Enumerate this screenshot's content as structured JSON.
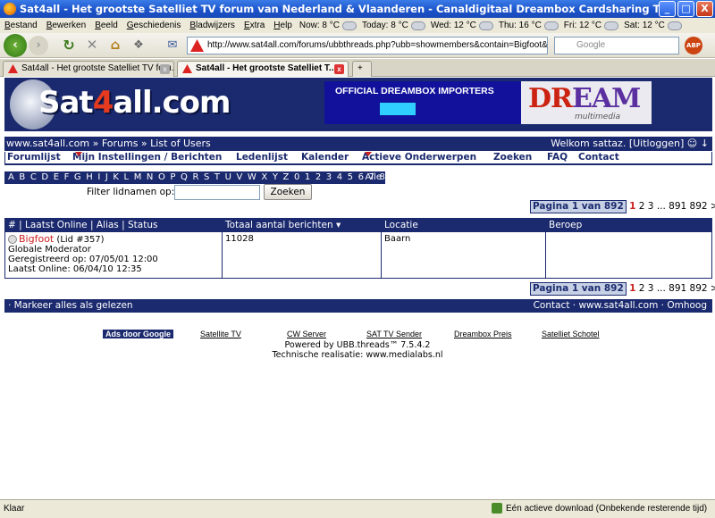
{
  "window": {
    "title": "Sat4all - Het grootste Satelliet TV forum van Nederland & Vlaanderen - Canaldigitaal Dreambox Cardsharing Topfield Humax DGstation Dbox - Mozill...",
    "min": "_",
    "max": "□",
    "close": "X"
  },
  "menu": {
    "items": [
      "Bestand",
      "Bewerken",
      "Beeld",
      "Geschiedenis",
      "Bladwijzers",
      "Extra",
      "Help"
    ],
    "weather": [
      {
        "label": "Now: 8 °C"
      },
      {
        "label": "Today: 8 °C"
      },
      {
        "label": "Wed: 12 °C"
      },
      {
        "label": "Thu: 16 °C"
      },
      {
        "label": "Fri: 12 °C"
      },
      {
        "label": "Sat: 12 °C"
      }
    ]
  },
  "nav": {
    "url": "http://www.sat4all.com/forums/ubbthreads.php?ubb=showmembers&contain=Bigfoot&sendi",
    "search_placeholder": "Google",
    "abp": "ABP"
  },
  "tabs": [
    {
      "label": "Sat4all - Het grootste Satelliet TV foru..."
    },
    {
      "label": "Sat4all - Het grootste Satelliet T..."
    }
  ],
  "banner": {
    "logo_pre": "Sat",
    "logo_four": "4",
    "logo_post": "all.com",
    "ad_text": "OFFICIAL DREAMBOX IMPORTERS",
    "dream_dr": "DR",
    "dream_am": "EAM",
    "dream_sub": "multimedia"
  },
  "breadcrumb": {
    "path": "www.sat4all.com » Forums » List of Users",
    "welcome": "Welkom sattaz. [Uitloggen] ☺ ↓"
  },
  "navlinks": [
    "Forumlijst",
    "Mijn Instellingen / Berichten",
    "Ledenlijst",
    "Kalender",
    "Actieve Onderwerpen",
    "Zoeken",
    "FAQ",
    "Contact"
  ],
  "alpha": {
    "letters": "A B C D E F G H I J K L M N O P Q R S T U V W X Y Z   0 1 2 3 4 5 6 7 8 9",
    "all": "Alle"
  },
  "filter": {
    "label": "Filter lidnamen op:",
    "button": "Zoeken"
  },
  "pager": {
    "label": "Pagina 1 van 892",
    "current": "1",
    "pages": "2 3 ... 891 892 >"
  },
  "table": {
    "headers": [
      "# | Laatst Online | Alias | Status",
      "Totaal aantal berichten ▾",
      "Locatie",
      "Beroep"
    ],
    "row": {
      "name": "Bigfoot",
      "member_id": "(Lid #357)",
      "status": "Globale Moderator",
      "registered": "Geregistreerd op: 07/05/01 12:00",
      "last_online": "Laatst Online: 06/04/10 12:35",
      "posts": "11028",
      "location": "Baarn",
      "profession": ""
    }
  },
  "footbar": {
    "mark_read": "· Markeer alles als gelezen",
    "right": "Contact · www.sat4all.com · Omhoog"
  },
  "ads": {
    "label": "Ads door Google",
    "links": [
      "Satellite TV",
      "CW Server",
      "SAT TV Sender",
      "Dreambox Preis",
      "Satelliet Schotel"
    ]
  },
  "powered": {
    "line1": "Powered by UBB.threads™ 7.5.4.2",
    "line2": "Technische realisatie: www.medialabs.nl"
  },
  "status": {
    "left": "Klaar",
    "download": "Eén actieve download (Onbekende resterende tijd)"
  },
  "colors": {
    "forum_navy": "#1b2a6e",
    "accent_red": "#c22",
    "xp_blue": "#1b52c8"
  }
}
